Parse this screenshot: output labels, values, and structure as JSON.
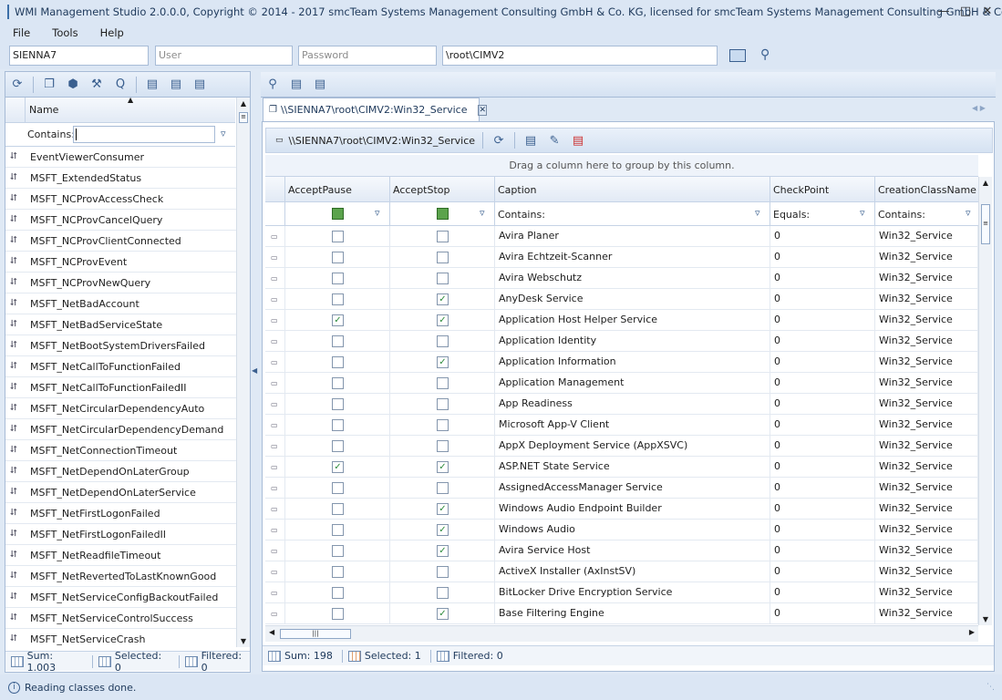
{
  "window": {
    "title": "WMI Management Studio 2.0.0.0, Copyright © 2014 - 2017 smcTeam Systems Management Consulting GmbH & Co. KG, licensed for smcTeam Systems Management Consulting GmbH & Co. KG"
  },
  "menu": [
    "File",
    "Tools",
    "Help"
  ],
  "connection": {
    "computer": "SIENNA7",
    "user_placeholder": "User",
    "password_placeholder": "Password",
    "namespace": "\\root\\CIMV2"
  },
  "left": {
    "column_header": "Name",
    "filter_label": "Contains:",
    "classes": [
      "EventViewerConsumer",
      "MSFT_ExtendedStatus",
      "MSFT_NCProvAccessCheck",
      "MSFT_NCProvCancelQuery",
      "MSFT_NCProvClientConnected",
      "MSFT_NCProvEvent",
      "MSFT_NCProvNewQuery",
      "MSFT_NetBadAccount",
      "MSFT_NetBadServiceState",
      "MSFT_NetBootSystemDriversFailed",
      "MSFT_NetCallToFunctionFailed",
      "MSFT_NetCallToFunctionFailedII",
      "MSFT_NetCircularDependencyAuto",
      "MSFT_NetCircularDependencyDemand",
      "MSFT_NetConnectionTimeout",
      "MSFT_NetDependOnLaterGroup",
      "MSFT_NetDependOnLaterService",
      "MSFT_NetFirstLogonFailed",
      "MSFT_NetFirstLogonFailedII",
      "MSFT_NetReadfileTimeout",
      "MSFT_NetRevertedToLastKnownGood",
      "MSFT_NetServiceConfigBackoutFailed",
      "MSFT_NetServiceControlSuccess",
      "MSFT_NetServiceCrash"
    ],
    "status": {
      "sum": "Sum: 1.003",
      "selected": "Selected: 0",
      "filtered": "Filtered: 0"
    }
  },
  "right": {
    "tab_title": "\\\\SIENNA7\\root\\CIMV2:Win32_Service",
    "path_label": "\\\\SIENNA7\\root\\CIMV2:Win32_Service",
    "group_hint": "Drag a column here to group by this column.",
    "columns": [
      "AcceptPause",
      "AcceptStop",
      "Caption",
      "CheckPoint",
      "CreationClassName"
    ],
    "filters": {
      "caption": "Contains:",
      "checkpoint": "Equals:",
      "creation": "Contains:"
    },
    "rows": [
      {
        "pause": false,
        "stop": false,
        "caption": "Avira Planer",
        "checkpoint": "0",
        "cls": "Win32_Service"
      },
      {
        "pause": false,
        "stop": false,
        "caption": "Avira Echtzeit-Scanner",
        "checkpoint": "0",
        "cls": "Win32_Service"
      },
      {
        "pause": false,
        "stop": false,
        "caption": "Avira Webschutz",
        "checkpoint": "0",
        "cls": "Win32_Service"
      },
      {
        "pause": false,
        "stop": true,
        "caption": "AnyDesk Service",
        "checkpoint": "0",
        "cls": "Win32_Service"
      },
      {
        "pause": true,
        "stop": true,
        "caption": "Application Host Helper Service",
        "checkpoint": "0",
        "cls": "Win32_Service"
      },
      {
        "pause": false,
        "stop": false,
        "caption": "Application Identity",
        "checkpoint": "0",
        "cls": "Win32_Service"
      },
      {
        "pause": false,
        "stop": true,
        "caption": "Application Information",
        "checkpoint": "0",
        "cls": "Win32_Service"
      },
      {
        "pause": false,
        "stop": false,
        "caption": "Application Management",
        "checkpoint": "0",
        "cls": "Win32_Service"
      },
      {
        "pause": false,
        "stop": false,
        "caption": "App Readiness",
        "checkpoint": "0",
        "cls": "Win32_Service"
      },
      {
        "pause": false,
        "stop": false,
        "caption": "Microsoft App-V Client",
        "checkpoint": "0",
        "cls": "Win32_Service"
      },
      {
        "pause": false,
        "stop": false,
        "caption": "AppX Deployment Service (AppXSVC)",
        "checkpoint": "0",
        "cls": "Win32_Service"
      },
      {
        "pause": true,
        "stop": true,
        "caption": "ASP.NET State Service",
        "checkpoint": "0",
        "cls": "Win32_Service"
      },
      {
        "pause": false,
        "stop": false,
        "caption": "AssignedAccessManager Service",
        "checkpoint": "0",
        "cls": "Win32_Service"
      },
      {
        "pause": false,
        "stop": true,
        "caption": "Windows Audio Endpoint Builder",
        "checkpoint": "0",
        "cls": "Win32_Service"
      },
      {
        "pause": false,
        "stop": true,
        "caption": "Windows Audio",
        "checkpoint": "0",
        "cls": "Win32_Service"
      },
      {
        "pause": false,
        "stop": true,
        "caption": "Avira Service Host",
        "checkpoint": "0",
        "cls": "Win32_Service"
      },
      {
        "pause": false,
        "stop": false,
        "caption": "ActiveX Installer (AxInstSV)",
        "checkpoint": "0",
        "cls": "Win32_Service"
      },
      {
        "pause": false,
        "stop": false,
        "caption": "BitLocker Drive Encryption Service",
        "checkpoint": "0",
        "cls": "Win32_Service"
      },
      {
        "pause": false,
        "stop": true,
        "caption": "Base Filtering Engine",
        "checkpoint": "0",
        "cls": "Win32_Service"
      }
    ],
    "status": {
      "sum": "Sum: 198",
      "selected": "Selected: 1",
      "filtered": "Filtered: 0"
    }
  },
  "statusbar": {
    "message": "Reading classes done."
  }
}
